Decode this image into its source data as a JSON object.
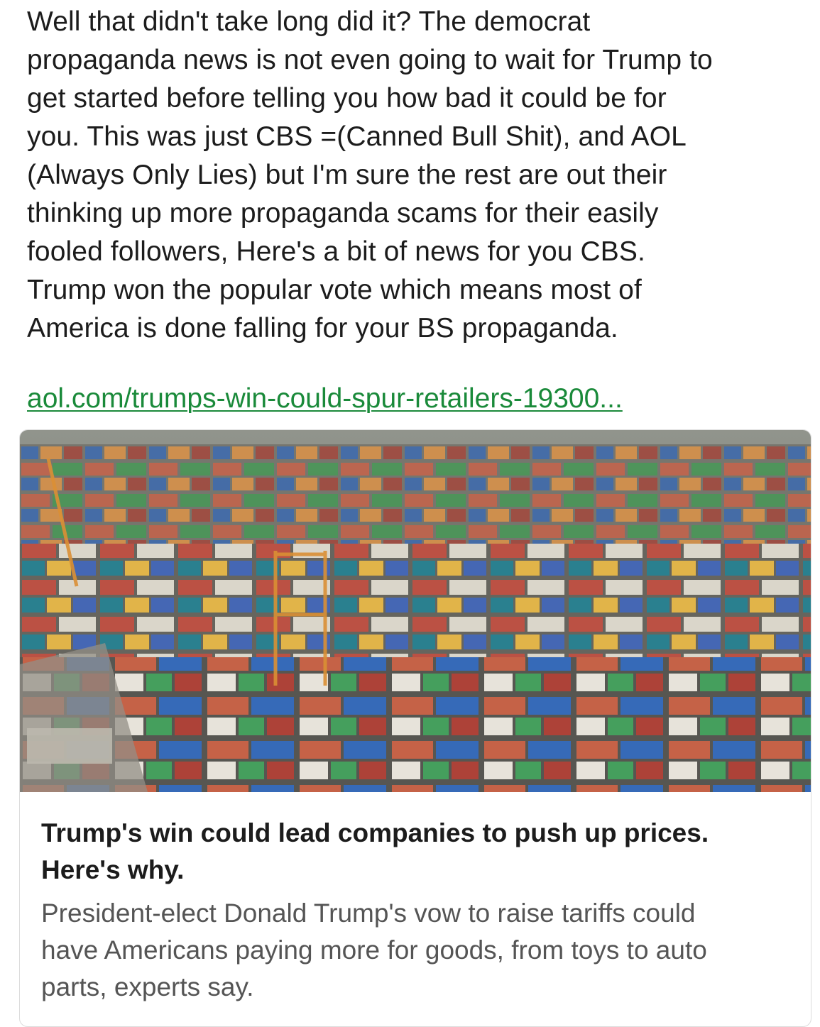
{
  "post": {
    "text": "Well that didn't take long did it? The democrat\npropaganda news is not even going to wait for Trump to\nget started before telling you how bad it could be for\nyou. This was just CBS =(Canned Bull Shit), and AOL\n(Always Only Lies) but I'm sure the rest are out their\nthinking up more propaganda scams for their easily\nfooled followers, Here's a bit of news for you CBS.\nTrump won the popular vote which means most of\nAmerica is done falling for your BS propaganda.",
    "link_text": "aol.com/trumps-win-could-spur-retailers-19300..."
  },
  "link_card": {
    "image_description_icon": "shipping-containers-photo",
    "title": "Trump's win could lead companies to push up prices.\nHere's why.",
    "description": "President-elect Donald Trump's vow to raise tariffs could\nhave Americans paying more for goods, from toys to auto\nparts, experts say."
  },
  "colors": {
    "link": "#1a8a3a",
    "text": "#1c1c1c",
    "muted": "#555555",
    "border": "#dcdcdc"
  }
}
